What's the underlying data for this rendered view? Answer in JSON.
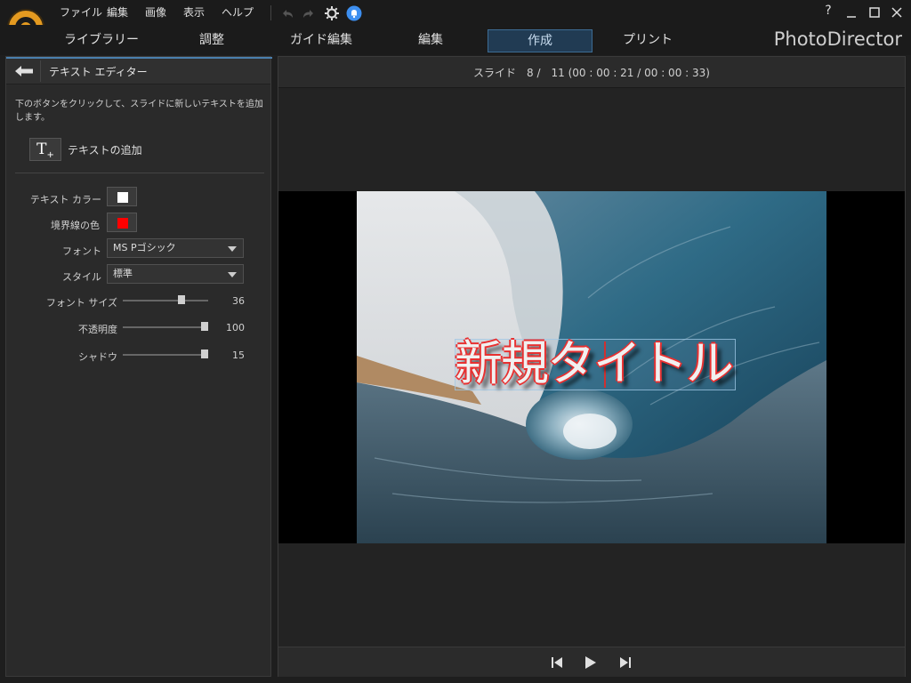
{
  "menubar": {
    "items": [
      "ファイル",
      "編集",
      "画像",
      "表示",
      "ヘルプ"
    ],
    "help_glyph": "?"
  },
  "nav": {
    "tabs": [
      "ライブラリー",
      "調整",
      "ガイド編集",
      "編集",
      "作成",
      "プリント"
    ],
    "active_tab": "作成",
    "brand": "PhotoDirector"
  },
  "left_panel": {
    "title": "テキスト エディター",
    "hint": "下のボタンをクリックして、スライドに新しいテキストを追加します。",
    "add_button_glyph": "T",
    "add_label": "テキストの追加",
    "text_color_label": "テキスト カラー",
    "text_color": "#ffffff",
    "border_color_label": "境界線の色",
    "border_color": "#ff0000",
    "font_label": "フォント",
    "font_value": "MS Pゴシック",
    "style_label": "スタイル",
    "style_value": "標準",
    "font_size_label": "フォント サイズ",
    "font_size_value": "36",
    "opacity_label": "不透明度",
    "opacity_value": "100",
    "shadow_label": "シャドウ",
    "shadow_value": "15"
  },
  "right_panel": {
    "slide_info": "スライド　8 /　11 (00 : 00 : 21 / 00 : 00 : 33)",
    "overlay_text": "新規タイトル"
  },
  "colors": {
    "accent": "#4a7fae",
    "active_tab_bg": "#213b53",
    "logo": "#e49a20"
  },
  "icons": [
    "undo-icon",
    "redo-icon",
    "gear-icon",
    "notification-icon",
    "back-arrow-icon",
    "text-add-icon",
    "prev-icon",
    "play-icon",
    "next-icon",
    "minimize-icon",
    "maximize-icon",
    "close-icon"
  ]
}
